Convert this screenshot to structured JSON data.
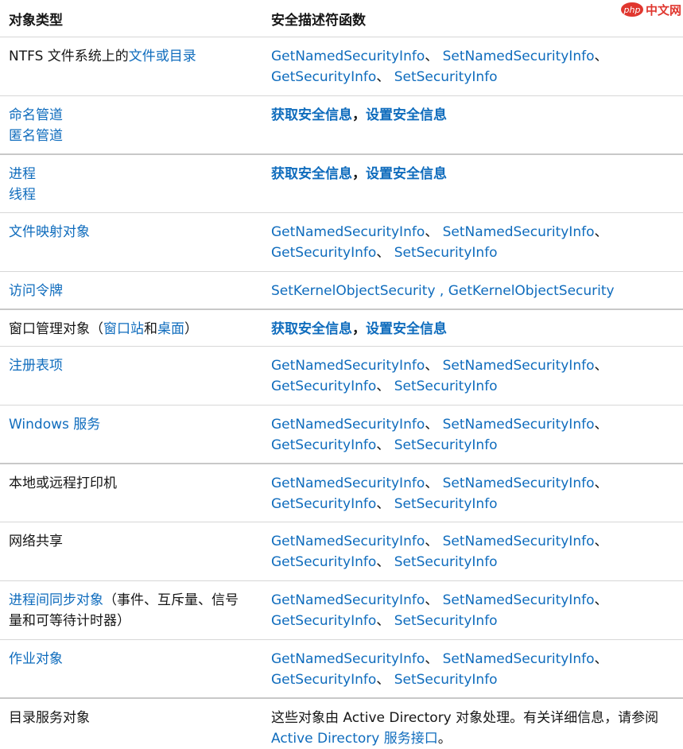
{
  "header": {
    "col1": "对象类型",
    "col2": "安全描述符函数"
  },
  "watermark": {
    "logo": "php",
    "text": "中文网",
    "color": "#e0372f"
  },
  "colors": {
    "link": "#0f6cbd",
    "text": "#161616"
  },
  "rows": [
    {
      "type": [
        {
          "text": "NTFS 文件系统上的",
          "link": false
        },
        {
          "text": "文件或目录",
          "link": true
        }
      ],
      "funcs": [
        "GetNamedSecurityInfo",
        "、 ",
        "SetNamedSecurityInfo",
        "、",
        "GetSecurityInfo",
        "、 ",
        "SetSecurityInfo"
      ]
    },
    {
      "type_lines": [
        "命名管道",
        "匿名管道"
      ],
      "funcs_bold": [
        "获取安全信息",
        "，",
        "设置安全信息"
      ]
    },
    {
      "type_lines": [
        "进程",
        "线程"
      ],
      "funcs_bold": [
        "获取安全信息",
        "，",
        "设置安全信息"
      ]
    },
    {
      "type_link": "文件映射对象",
      "funcs": [
        "GetNamedSecurityInfo",
        "、 ",
        "SetNamedSecurityInfo",
        "、",
        "GetSecurityInfo",
        "、 ",
        "SetSecurityInfo"
      ]
    },
    {
      "type_link": "访问令牌",
      "funcs_single": [
        "SetKernelObjectSecurity",
        " , ",
        "GetKernelObjectSecurity"
      ]
    },
    {
      "type": [
        {
          "text": "窗口管理对象（",
          "link": false
        },
        {
          "text": "窗口站",
          "link": true
        },
        {
          "text": "和",
          "link": false
        },
        {
          "text": "桌面",
          "link": true
        },
        {
          "text": "）",
          "link": false
        }
      ],
      "funcs_bold": [
        "获取安全信息",
        "，",
        "设置安全信息"
      ]
    },
    {
      "type_link": "注册表项",
      "funcs": [
        "GetNamedSecurityInfo",
        "、 ",
        "SetNamedSecurityInfo",
        "、",
        "GetSecurityInfo",
        "、 ",
        "SetSecurityInfo"
      ]
    },
    {
      "type_link": "Windows 服务",
      "funcs": [
        "GetNamedSecurityInfo",
        "、 ",
        "SetNamedSecurityInfo",
        "、",
        "GetSecurityInfo",
        "、 ",
        "SetSecurityInfo"
      ]
    },
    {
      "type_plain": "本地或远程打印机",
      "funcs": [
        "GetNamedSecurityInfo",
        "、 ",
        "SetNamedSecurityInfo",
        "、",
        "GetSecurityInfo",
        "、 ",
        "SetSecurityInfo"
      ]
    },
    {
      "type_plain": "网络共享",
      "funcs": [
        "GetNamedSecurityInfo",
        "、 ",
        "SetNamedSecurityInfo",
        "、",
        "GetSecurityInfo",
        "、 ",
        "SetSecurityInfo"
      ]
    },
    {
      "type_ipc": {
        "link": "进程间同步对象",
        "rest1": "（事件、互斥量、信号",
        "rest2": "量和可等待计时器）"
      },
      "funcs": [
        "GetNamedSecurityInfo",
        "、 ",
        "SetNamedSecurityInfo",
        "、",
        "GetSecurityInfo",
        "、 ",
        "SetSecurityInfo"
      ]
    },
    {
      "type_link": "作业对象",
      "funcs": [
        "GetNamedSecurityInfo",
        "、 ",
        "SetNamedSecurityInfo",
        "、",
        "GetSecurityInfo",
        "、 ",
        "SetSecurityInfo"
      ]
    },
    {
      "type_plain": "目录服务对象",
      "desc": {
        "line1": "这些对象由 Active Directory 对象处理。有关详细信息，请参阅",
        "link": "Active Directory 服务接口",
        "tail": "。"
      }
    }
  ]
}
